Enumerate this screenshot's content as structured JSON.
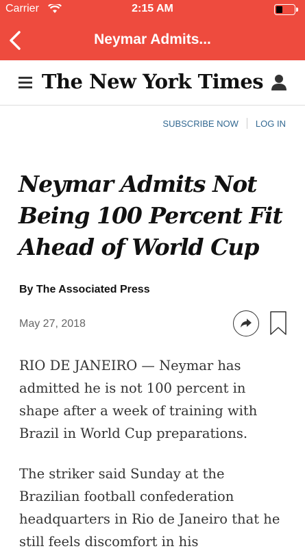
{
  "colors": {
    "accent": "#ee4b3e",
    "link": "#326891"
  },
  "status_bar": {
    "carrier": "Carrier",
    "time": "2:15 AM",
    "battery_icon": "battery-icon",
    "wifi_icon": "wifi-icon"
  },
  "nav": {
    "back_icon": "chevron-left-icon",
    "title": "Neymar Admits..."
  },
  "header": {
    "menu_icon": "hamburger-icon",
    "logo": "The New York Times",
    "account_icon": "account-icon"
  },
  "links": {
    "subscribe": "SUBSCRIBE NOW",
    "login": "LOG IN"
  },
  "article": {
    "headline": "Neymar Admits Not Being 100 Percent Fit Ahead of World Cup",
    "byline": "By The Associated Press",
    "date": "May 27, 2018",
    "share_icon": "share-icon",
    "bookmark_icon": "bookmark-icon",
    "paragraphs": [
      "RIO DE JANEIRO — Neymar has admitted he is not 100 percent in shape after a week of training with Brazil in World Cup preparations.",
      "The striker said Sunday at the Brazilian football confederation headquarters in Rio de Janeiro that he still feels discomfort in his"
    ]
  }
}
